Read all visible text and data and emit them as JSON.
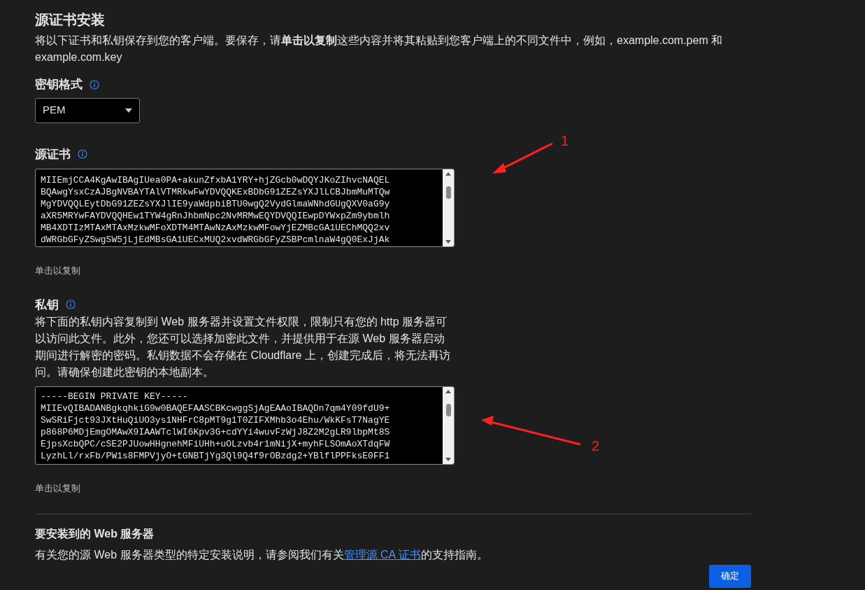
{
  "title": "源证书安装",
  "intro": "将以下证书和私钥保存到您的客户端。要保存，请**单击以复制**这些内容并将其粘贴到您客户端上的不同文件中，例如，example.com.pem 和 example.com.key",
  "key_format": {
    "label": "密钥格式",
    "value": "PEM"
  },
  "certificate": {
    "label": "源证书",
    "lines": [
      "MIIEmjCCA4KgAwIBAgIUea0PA+akunZfxbA1YRY+hjZGcb0wDQYJKoZIhvcNAQEL",
      "BQAwgYsxCzAJBgNVBAYTAlVTMRkwFwYDVQQKExBDbG91ZEZsYXJlLCBJbmMuMTQw",
      "MgYDVQQLEytDbG91ZEZsYXJlIE9yaWdpbiBTU0wgQ2VydGlmaWNhdGUgQXV0aG9y",
      "aXR5MRYwFAYDVQQHEw1TYW4gRnJhbmNpc2NvMRMwEQYDVQQIEwpDYWxpZm9ybmlh",
      "MB4XDTIzMTAxMTAxMzkwMFoXDTM4MTAwNzAxMzkwMFowYjEZMBcGA1UEChMQQ2xv",
      "dWRGbGFyZSwgSW5jLjEdMBsGA1UECxMUQ2xvdWRGbGFyZSBPcmlnaW4gQ0ExJjAk"
    ],
    "copy_hint": "单击以复制"
  },
  "private_key": {
    "label": "私钥",
    "description": "将下面的私钥内容复制到 Web 服务器并设置文件权限，限制只有您的 http 服务器可以访问此文件。此外，您还可以选择加密此文件，并提供用于在源 Web 服务器启动期间进行解密的密码。私钥数据不会存储在 Cloudflare 上，创建完成后，将无法再访问。请确保创建此密钥的本地副本。",
    "lines": [
      "-----BEGIN PRIVATE KEY-----",
      "MIIEvQIBADANBgkqhkiG9w0BAQEFAASCBKcwggSjAgEAAoIBAQDn7qm4Y09fdU9+",
      "SwSRiFjct93JXtHuQiUO3ys1NHFrC8pMT9g1T0ZIFXMhb3o4Ehu/WkKFsT7NagYE",
      "p868P6MDjEmgOMAwX9IAAWTclWI6Kpv3G+cdYYi4wuvFzWjJ8Z2M2gLR9lbpMt8S",
      "EjpsXcbQPC/cSE2PJUowHHgnehMFiUHh+uOLzvb4r1mNijX+myhFLSOmAoXTdqFW",
      "LyzhLl/rxFb/PW1s8FMPVjyO+tGNBTjYg3Ql9Q4f9rOBzdg2+YBlflPPFksE0FF1"
    ],
    "copy_hint": "单击以复制"
  },
  "web_server": {
    "title": "要安装到的 Web 服务器",
    "text_before": "有关您的源 Web 服务器类型的特定安装说明，请参阅我们有关",
    "link": "管理源 CA 证书",
    "text_after": "的支持指南。"
  },
  "confirm_button": "确定",
  "annotations": [
    {
      "label": "1"
    },
    {
      "label": "2"
    }
  ]
}
